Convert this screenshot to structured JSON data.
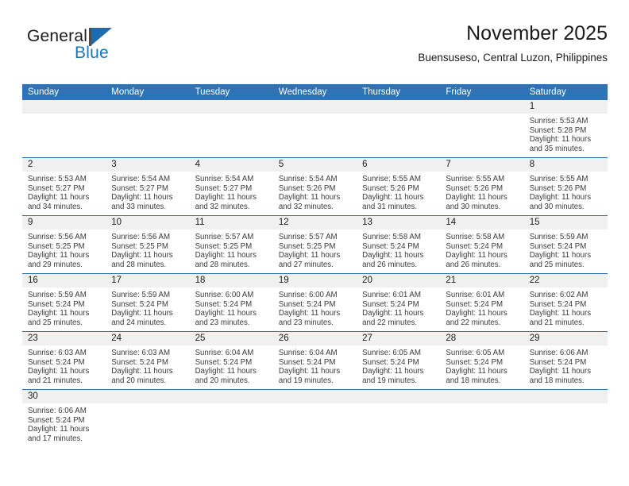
{
  "brand": {
    "name_dark": "General",
    "name_blue": "Blue",
    "accent_color": "#1b75bb",
    "header_color": "#2e73b5"
  },
  "header": {
    "title": "November 2025",
    "subtitle": "Buensuseso, Central Luzon, Philippines"
  },
  "calendar": {
    "weekdays": [
      "Sunday",
      "Monday",
      "Tuesday",
      "Wednesday",
      "Thursday",
      "Friday",
      "Saturday"
    ],
    "weeks": [
      [
        {
          "day": "",
          "sunrise": "",
          "sunset": "",
          "daylight": "",
          "daylight2": ""
        },
        {
          "day": "",
          "sunrise": "",
          "sunset": "",
          "daylight": "",
          "daylight2": ""
        },
        {
          "day": "",
          "sunrise": "",
          "sunset": "",
          "daylight": "",
          "daylight2": ""
        },
        {
          "day": "",
          "sunrise": "",
          "sunset": "",
          "daylight": "",
          "daylight2": ""
        },
        {
          "day": "",
          "sunrise": "",
          "sunset": "",
          "daylight": "",
          "daylight2": ""
        },
        {
          "day": "",
          "sunrise": "",
          "sunset": "",
          "daylight": "",
          "daylight2": ""
        },
        {
          "day": "1",
          "sunrise": "Sunrise: 5:53 AM",
          "sunset": "Sunset: 5:28 PM",
          "daylight": "Daylight: 11 hours",
          "daylight2": "and 35 minutes."
        }
      ],
      [
        {
          "day": "2",
          "sunrise": "Sunrise: 5:53 AM",
          "sunset": "Sunset: 5:27 PM",
          "daylight": "Daylight: 11 hours",
          "daylight2": "and 34 minutes."
        },
        {
          "day": "3",
          "sunrise": "Sunrise: 5:54 AM",
          "sunset": "Sunset: 5:27 PM",
          "daylight": "Daylight: 11 hours",
          "daylight2": "and 33 minutes."
        },
        {
          "day": "4",
          "sunrise": "Sunrise: 5:54 AM",
          "sunset": "Sunset: 5:27 PM",
          "daylight": "Daylight: 11 hours",
          "daylight2": "and 32 minutes."
        },
        {
          "day": "5",
          "sunrise": "Sunrise: 5:54 AM",
          "sunset": "Sunset: 5:26 PM",
          "daylight": "Daylight: 11 hours",
          "daylight2": "and 32 minutes."
        },
        {
          "day": "6",
          "sunrise": "Sunrise: 5:55 AM",
          "sunset": "Sunset: 5:26 PM",
          "daylight": "Daylight: 11 hours",
          "daylight2": "and 31 minutes."
        },
        {
          "day": "7",
          "sunrise": "Sunrise: 5:55 AM",
          "sunset": "Sunset: 5:26 PM",
          "daylight": "Daylight: 11 hours",
          "daylight2": "and 30 minutes."
        },
        {
          "day": "8",
          "sunrise": "Sunrise: 5:55 AM",
          "sunset": "Sunset: 5:26 PM",
          "daylight": "Daylight: 11 hours",
          "daylight2": "and 30 minutes."
        }
      ],
      [
        {
          "day": "9",
          "sunrise": "Sunrise: 5:56 AM",
          "sunset": "Sunset: 5:25 PM",
          "daylight": "Daylight: 11 hours",
          "daylight2": "and 29 minutes."
        },
        {
          "day": "10",
          "sunrise": "Sunrise: 5:56 AM",
          "sunset": "Sunset: 5:25 PM",
          "daylight": "Daylight: 11 hours",
          "daylight2": "and 28 minutes."
        },
        {
          "day": "11",
          "sunrise": "Sunrise: 5:57 AM",
          "sunset": "Sunset: 5:25 PM",
          "daylight": "Daylight: 11 hours",
          "daylight2": "and 28 minutes."
        },
        {
          "day": "12",
          "sunrise": "Sunrise: 5:57 AM",
          "sunset": "Sunset: 5:25 PM",
          "daylight": "Daylight: 11 hours",
          "daylight2": "and 27 minutes."
        },
        {
          "day": "13",
          "sunrise": "Sunrise: 5:58 AM",
          "sunset": "Sunset: 5:24 PM",
          "daylight": "Daylight: 11 hours",
          "daylight2": "and 26 minutes."
        },
        {
          "day": "14",
          "sunrise": "Sunrise: 5:58 AM",
          "sunset": "Sunset: 5:24 PM",
          "daylight": "Daylight: 11 hours",
          "daylight2": "and 26 minutes."
        },
        {
          "day": "15",
          "sunrise": "Sunrise: 5:59 AM",
          "sunset": "Sunset: 5:24 PM",
          "daylight": "Daylight: 11 hours",
          "daylight2": "and 25 minutes."
        }
      ],
      [
        {
          "day": "16",
          "sunrise": "Sunrise: 5:59 AM",
          "sunset": "Sunset: 5:24 PM",
          "daylight": "Daylight: 11 hours",
          "daylight2": "and 25 minutes."
        },
        {
          "day": "17",
          "sunrise": "Sunrise: 5:59 AM",
          "sunset": "Sunset: 5:24 PM",
          "daylight": "Daylight: 11 hours",
          "daylight2": "and 24 minutes."
        },
        {
          "day": "18",
          "sunrise": "Sunrise: 6:00 AM",
          "sunset": "Sunset: 5:24 PM",
          "daylight": "Daylight: 11 hours",
          "daylight2": "and 23 minutes."
        },
        {
          "day": "19",
          "sunrise": "Sunrise: 6:00 AM",
          "sunset": "Sunset: 5:24 PM",
          "daylight": "Daylight: 11 hours",
          "daylight2": "and 23 minutes."
        },
        {
          "day": "20",
          "sunrise": "Sunrise: 6:01 AM",
          "sunset": "Sunset: 5:24 PM",
          "daylight": "Daylight: 11 hours",
          "daylight2": "and 22 minutes."
        },
        {
          "day": "21",
          "sunrise": "Sunrise: 6:01 AM",
          "sunset": "Sunset: 5:24 PM",
          "daylight": "Daylight: 11 hours",
          "daylight2": "and 22 minutes."
        },
        {
          "day": "22",
          "sunrise": "Sunrise: 6:02 AM",
          "sunset": "Sunset: 5:24 PM",
          "daylight": "Daylight: 11 hours",
          "daylight2": "and 21 minutes."
        }
      ],
      [
        {
          "day": "23",
          "sunrise": "Sunrise: 6:03 AM",
          "sunset": "Sunset: 5:24 PM",
          "daylight": "Daylight: 11 hours",
          "daylight2": "and 21 minutes."
        },
        {
          "day": "24",
          "sunrise": "Sunrise: 6:03 AM",
          "sunset": "Sunset: 5:24 PM",
          "daylight": "Daylight: 11 hours",
          "daylight2": "and 20 minutes."
        },
        {
          "day": "25",
          "sunrise": "Sunrise: 6:04 AM",
          "sunset": "Sunset: 5:24 PM",
          "daylight": "Daylight: 11 hours",
          "daylight2": "and 20 minutes."
        },
        {
          "day": "26",
          "sunrise": "Sunrise: 6:04 AM",
          "sunset": "Sunset: 5:24 PM",
          "daylight": "Daylight: 11 hours",
          "daylight2": "and 19 minutes."
        },
        {
          "day": "27",
          "sunrise": "Sunrise: 6:05 AM",
          "sunset": "Sunset: 5:24 PM",
          "daylight": "Daylight: 11 hours",
          "daylight2": "and 19 minutes."
        },
        {
          "day": "28",
          "sunrise": "Sunrise: 6:05 AM",
          "sunset": "Sunset: 5:24 PM",
          "daylight": "Daylight: 11 hours",
          "daylight2": "and 18 minutes."
        },
        {
          "day": "29",
          "sunrise": "Sunrise: 6:06 AM",
          "sunset": "Sunset: 5:24 PM",
          "daylight": "Daylight: 11 hours",
          "daylight2": "and 18 minutes."
        }
      ],
      [
        {
          "day": "30",
          "sunrise": "Sunrise: 6:06 AM",
          "sunset": "Sunset: 5:24 PM",
          "daylight": "Daylight: 11 hours",
          "daylight2": "and 17 minutes."
        },
        {
          "day": "",
          "sunrise": "",
          "sunset": "",
          "daylight": "",
          "daylight2": ""
        },
        {
          "day": "",
          "sunrise": "",
          "sunset": "",
          "daylight": "",
          "daylight2": ""
        },
        {
          "day": "",
          "sunrise": "",
          "sunset": "",
          "daylight": "",
          "daylight2": ""
        },
        {
          "day": "",
          "sunrise": "",
          "sunset": "",
          "daylight": "",
          "daylight2": ""
        },
        {
          "day": "",
          "sunrise": "",
          "sunset": "",
          "daylight": "",
          "daylight2": ""
        },
        {
          "day": "",
          "sunrise": "",
          "sunset": "",
          "daylight": "",
          "daylight2": ""
        }
      ]
    ]
  }
}
